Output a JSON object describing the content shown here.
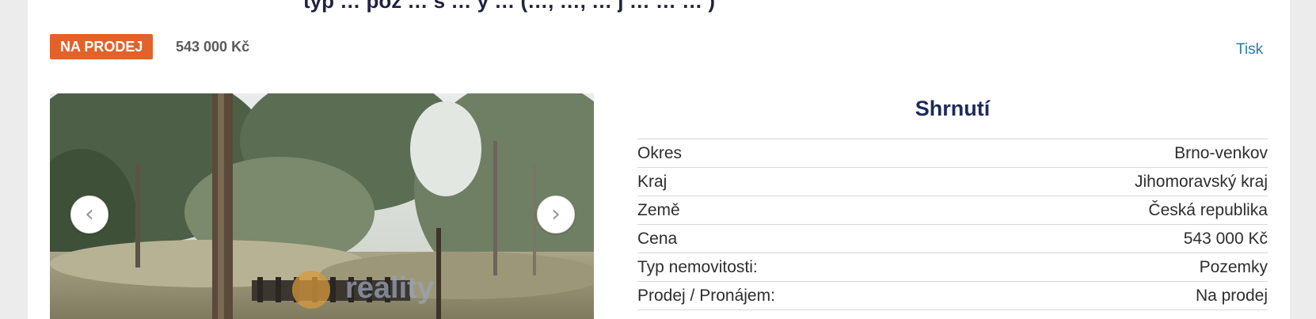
{
  "header": {
    "title_partial": "typ … poz … s … ý … (…, …, … j … … … )"
  },
  "listing": {
    "badge_label": "NA PRODEJ",
    "price": "543 000 Kč",
    "print_label": "Tisk"
  },
  "gallery": {
    "prev_label": "‹",
    "next_label": "›",
    "watermark_text": "reality",
    "accent_color": "#e2622a"
  },
  "summary": {
    "title": "Shrnutí",
    "rows": [
      {
        "label": "Okres",
        "value": "Brno-venkov"
      },
      {
        "label": "Kraj",
        "value": "Jihomoravský kraj"
      },
      {
        "label": "Země",
        "value": "Česká republika"
      },
      {
        "label": "Cena",
        "value": "543 000 Kč"
      },
      {
        "label": "Typ nemovitosti:",
        "value": "Pozemky"
      },
      {
        "label": "Prodej / Pronájem:",
        "value": "Na prodej"
      }
    ]
  }
}
